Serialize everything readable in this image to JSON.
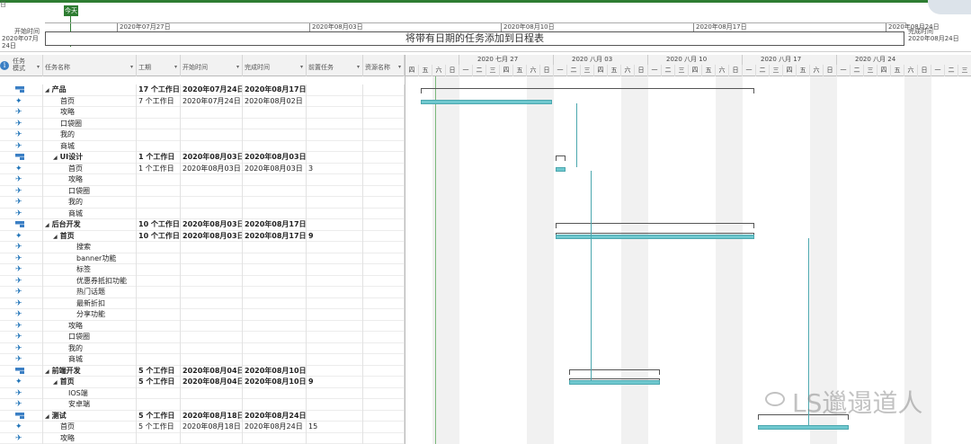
{
  "timeline": {
    "corner_tag": "日",
    "today_label": "今天",
    "start_label_1": "开始时间",
    "start_label_2": "2020年07月24日",
    "end_label_1": "完成时间",
    "end_label_2": "2020年08月24日",
    "ticks": [
      "2020年07月27日",
      "2020年08月03日",
      "2020年08月10日",
      "2020年08月17日",
      "2020年08月24日"
    ],
    "bar_text": "将带有日期的任务添加到日程表"
  },
  "table": {
    "headers": {
      "mode_1": "任务",
      "mode_2": "模式",
      "name": "任务名称",
      "duration": "工期",
      "start": "开始时间",
      "finish": "完成时间",
      "predecessors": "前置任务",
      "resources": "资源名称"
    },
    "rows": [
      {
        "type": "summary",
        "indent": 0,
        "name": "产品",
        "duration": "17 个工作日",
        "start": "2020年07月24日",
        "finish": "2020年08月17日",
        "pred": ""
      },
      {
        "type": "task",
        "indent": 1,
        "name": "首页",
        "duration": "7 个工作日",
        "start": "2020年07月24日",
        "finish": "2020年08月02日",
        "pred": ""
      },
      {
        "type": "manual",
        "indent": 1,
        "name": "攻略",
        "duration": "",
        "start": "",
        "finish": "",
        "pred": ""
      },
      {
        "type": "manual",
        "indent": 1,
        "name": "口袋圈",
        "duration": "",
        "start": "",
        "finish": "",
        "pred": ""
      },
      {
        "type": "manual",
        "indent": 1,
        "name": "我的",
        "duration": "",
        "start": "",
        "finish": "",
        "pred": ""
      },
      {
        "type": "manual",
        "indent": 1,
        "name": "商城",
        "duration": "",
        "start": "",
        "finish": "",
        "pred": ""
      },
      {
        "type": "summary",
        "indent": 1,
        "name": "UI设计",
        "duration": "1 个工作日",
        "start": "2020年08月03日",
        "finish": "2020年08月03日",
        "pred": ""
      },
      {
        "type": "task",
        "indent": 2,
        "name": "首页",
        "duration": "1 个工作日",
        "start": "2020年08月03日",
        "finish": "2020年08月03日",
        "pred": "3"
      },
      {
        "type": "manual",
        "indent": 2,
        "name": "攻略",
        "duration": "",
        "start": "",
        "finish": "",
        "pred": ""
      },
      {
        "type": "manual",
        "indent": 2,
        "name": "口袋圈",
        "duration": "",
        "start": "",
        "finish": "",
        "pred": ""
      },
      {
        "type": "manual",
        "indent": 2,
        "name": "我的",
        "duration": "",
        "start": "",
        "finish": "",
        "pred": ""
      },
      {
        "type": "manual",
        "indent": 2,
        "name": "商城",
        "duration": "",
        "start": "",
        "finish": "",
        "pred": ""
      },
      {
        "type": "summary",
        "indent": 0,
        "name": "后台开发",
        "duration": "10 个工作日",
        "start": "2020年08月03日",
        "finish": "2020年08月17日",
        "pred": ""
      },
      {
        "type": "summary-task",
        "indent": 1,
        "name": "首页",
        "duration": "10 个工作日",
        "start": "2020年08月03日",
        "finish": "2020年08月17日",
        "pred": "9"
      },
      {
        "type": "manual",
        "indent": 3,
        "name": "搜索",
        "duration": "",
        "start": "",
        "finish": "",
        "pred": ""
      },
      {
        "type": "manual",
        "indent": 3,
        "name": "banner功能",
        "duration": "",
        "start": "",
        "finish": "",
        "pred": ""
      },
      {
        "type": "manual",
        "indent": 3,
        "name": "标签",
        "duration": "",
        "start": "",
        "finish": "",
        "pred": ""
      },
      {
        "type": "manual",
        "indent": 3,
        "name": "优惠券抵扣功能",
        "duration": "",
        "start": "",
        "finish": "",
        "pred": ""
      },
      {
        "type": "manual",
        "indent": 3,
        "name": "热门话题",
        "duration": "",
        "start": "",
        "finish": "",
        "pred": ""
      },
      {
        "type": "manual",
        "indent": 3,
        "name": "最新折扣",
        "duration": "",
        "start": "",
        "finish": "",
        "pred": ""
      },
      {
        "type": "manual",
        "indent": 3,
        "name": "分享功能",
        "duration": "",
        "start": "",
        "finish": "",
        "pred": ""
      },
      {
        "type": "manual",
        "indent": 2,
        "name": "攻略",
        "duration": "",
        "start": "",
        "finish": "",
        "pred": ""
      },
      {
        "type": "manual",
        "indent": 2,
        "name": "口袋圈",
        "duration": "",
        "start": "",
        "finish": "",
        "pred": ""
      },
      {
        "type": "manual",
        "indent": 2,
        "name": "我的",
        "duration": "",
        "start": "",
        "finish": "",
        "pred": ""
      },
      {
        "type": "manual",
        "indent": 2,
        "name": "商城",
        "duration": "",
        "start": "",
        "finish": "",
        "pred": ""
      },
      {
        "type": "summary",
        "indent": 0,
        "name": "前端开发",
        "duration": "5 个工作日",
        "start": "2020年08月04日",
        "finish": "2020年08月10日",
        "pred": ""
      },
      {
        "type": "summary-task",
        "indent": 1,
        "name": "首页",
        "duration": "5 个工作日",
        "start": "2020年08月04日",
        "finish": "2020年08月10日",
        "pred": "9"
      },
      {
        "type": "manual",
        "indent": 2,
        "name": "IOS端",
        "duration": "",
        "start": "",
        "finish": "",
        "pred": ""
      },
      {
        "type": "manual",
        "indent": 2,
        "name": "安卓端",
        "duration": "",
        "start": "",
        "finish": "",
        "pred": ""
      },
      {
        "type": "summary",
        "indent": 0,
        "name": "测试",
        "duration": "5 个工作日",
        "start": "2020年08月18日",
        "finish": "2020年08月24日",
        "pred": ""
      },
      {
        "type": "task",
        "indent": 1,
        "name": "首页",
        "duration": "5 个工作日",
        "start": "2020年08月18日",
        "finish": "2020年08月24日",
        "pred": "15"
      },
      {
        "type": "manual",
        "indent": 1,
        "name": "攻略",
        "duration": "",
        "start": "",
        "finish": "",
        "pred": ""
      }
    ]
  },
  "gantt": {
    "weeks": [
      "",
      "2020 七月 27",
      "2020 八月 03",
      "2020 八月 10",
      "2020 八月 17",
      "2020 八月 24"
    ],
    "days": [
      "四",
      "五",
      "六",
      "日",
      "一",
      "二",
      "三",
      "四",
      "五",
      "六",
      "日",
      "一",
      "二",
      "三",
      "四",
      "五",
      "六",
      "日",
      "一",
      "二",
      "三",
      "四",
      "五",
      "六",
      "日",
      "一",
      "二",
      "三",
      "四",
      "五",
      "六",
      "日",
      "一",
      "二",
      "三",
      "四",
      "五",
      "六",
      "日",
      "一",
      "二",
      "三"
    ]
  },
  "watermark": "LS邋遢道人"
}
